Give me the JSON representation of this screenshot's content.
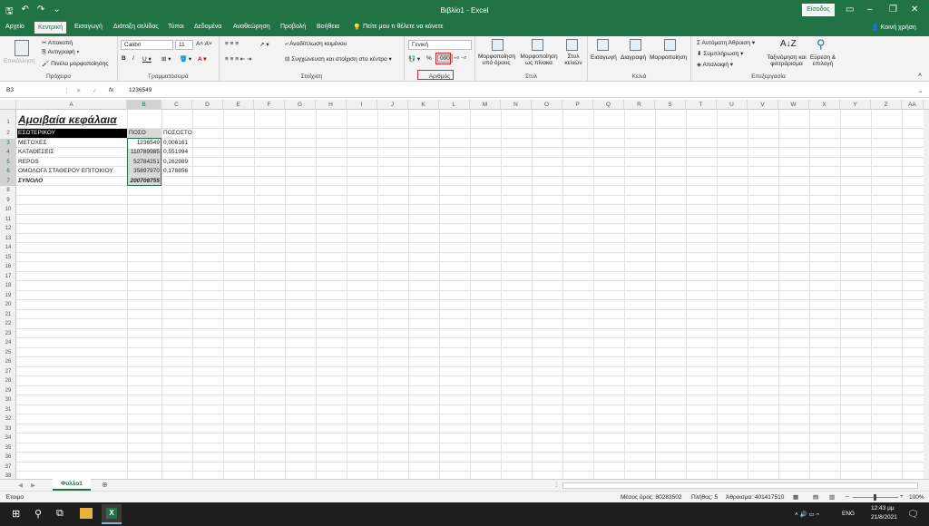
{
  "titlebar": {
    "title": "Βιβλίο1  -  Excel",
    "signin": "Είσοδος"
  },
  "tabs": [
    "Αρχείο",
    "Κεντρική",
    "Εισαγωγή",
    "Διάταξη σελίδας",
    "Τύποι",
    "Δεδομένα",
    "Αναθεώρηση",
    "Προβολή",
    "Βοήθεια",
    "Πείτε μου τι θέλετε να κάνετε"
  ],
  "share": "Κοινή χρήση",
  "ribbon": {
    "clipboard": {
      "paste": "Επικόλληση",
      "cut": "Αποκοπή",
      "copy": "Αντιγραφή",
      "painter": "Πινέλο μορφοποίησης",
      "label": "Πρόχειρο"
    },
    "font": {
      "name": "Calibri",
      "size": "11",
      "label": "Γραμματοσειρά"
    },
    "alignment": {
      "wrap": "Αναδίπλωση κειμένου",
      "merge": "Συγχώνευση και στοίχιση στο κέντρο",
      "label": "Στοίχιση"
    },
    "number": {
      "format": "Γενική",
      "label": "Αριθμός"
    },
    "styles": {
      "cond": "Μορφοποίηση υπό όρους",
      "table": "Μορφοποίηση ως πίνακα",
      "cell": "Στυλ κελιών",
      "label": "Στυλ"
    },
    "cells": {
      "insert": "Εισαγωγή",
      "delete": "Διαγραφή",
      "format": "Μορφοποίηση",
      "label": "Κελιά"
    },
    "editing": {
      "autosum": "Αυτόματη Άθροιση",
      "fill": "Συμπλήρωση",
      "clear": "Απαλοιφή",
      "sort": "Ταξινόμηση και φιλτράρισμα",
      "find": "Εύρεση & επιλογή",
      "label": "Επεξεργασία"
    }
  },
  "formula": {
    "namebox": "B3",
    "value": "1236549"
  },
  "columns": [
    "A",
    "B",
    "C",
    "D",
    "E",
    "F",
    "G",
    "H",
    "I",
    "J",
    "K",
    "L",
    "M",
    "N",
    "O",
    "P",
    "Q",
    "R",
    "S",
    "T",
    "U",
    "V",
    "W",
    "X",
    "Y",
    "Z",
    "AA"
  ],
  "cells": {
    "title": "Αμοιβαία κεφάλαια",
    "A2": "ΕΣΩΤΕΡΙΚΟΥ",
    "B2": "ΠΟΣΟ",
    "C2": "ΠΟΣΟΣΤΟ",
    "A3": "ΜΕΤΟΧΕΣ",
    "B3": "1236549",
    "C3": "0,006161",
    "A4": "ΚΑΤΑΘΕΣΕΙΣ",
    "B4": "110789985",
    "C4": "0,551994",
    "A5": "REPOS",
    "B5": "52784251",
    "C5": "0,262989",
    "A6": "ΟΜΟΛΟΓΑ ΣΤΑΘΕΡΟΥ ΕΠΙΤΟΚΙΟΥ",
    "B6": "35897970",
    "C6": "0,178856",
    "A7": "ΣΥΝΟΛΟ",
    "B7": "200708755"
  },
  "sheet": "Φύλλο1",
  "status": {
    "ready": "Έτοιμο",
    "avg": "Μέσος όρος: 80283502",
    "count": "Πλήθος: 5",
    "sum": "Άθροισμα: 401417510",
    "zoom": "100%"
  },
  "taskbar": {
    "lang": "ENG",
    "time": "12:43 μμ",
    "date": "21/8/2021"
  }
}
